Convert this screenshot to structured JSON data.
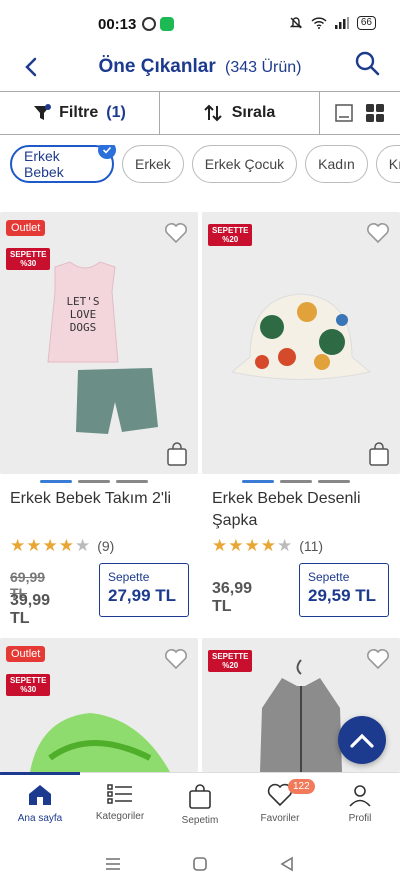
{
  "status_bar": {
    "time": "00:13",
    "battery": "66"
  },
  "header": {
    "title": "Öne Çıkanlar",
    "count": "(343 Ürün)"
  },
  "toolbar": {
    "filter_label": "Filtre",
    "filter_count": "(1)",
    "sort_label": "Sırala"
  },
  "chips": [
    "Erkek Bebek",
    "Erkek",
    "Erkek Çocuk",
    "Kadın",
    "Kız"
  ],
  "products": [
    {
      "name": "Erkek Bebek Takım 2'li",
      "outlet": "Outlet",
      "sale_badge_line1": "SEPETTE",
      "sale_badge_line2": "%30",
      "rating_count": "(9)",
      "old_price": "69,99 TL",
      "price": "39,99 TL",
      "basket_label": "Sepette",
      "basket_price": "27,99 TL",
      "stars": 4
    },
    {
      "name": "Erkek Bebek Desenli Şapka",
      "sale_badge_line1": "SEPETTE",
      "sale_badge_line2": "%20",
      "rating_count": "(11)",
      "price": "36,99 TL",
      "basket_label": "Sepette",
      "basket_price": "29,59 TL",
      "stars": 4
    },
    {
      "outlet": "Outlet",
      "sale_badge_line1": "SEPETTE",
      "sale_badge_line2": "%30"
    },
    {
      "sale_badge_line1": "SEPETTE",
      "sale_badge_line2": "%20"
    }
  ],
  "bottom_nav": [
    {
      "label": "Ana sayfa",
      "icon": "home-icon"
    },
    {
      "label": "Kategoriler",
      "icon": "categories-icon"
    },
    {
      "label": "Sepetim",
      "icon": "bag-icon"
    },
    {
      "label": "Favoriler",
      "icon": "heart-icon",
      "badge": "122"
    },
    {
      "label": "Profil",
      "icon": "user-icon"
    }
  ],
  "colors": {
    "brand": "#1d3b8e",
    "accent": "#3a7bd5",
    "sale": "#c8102e",
    "outlet": "#e53935",
    "star": "#e8a735"
  }
}
